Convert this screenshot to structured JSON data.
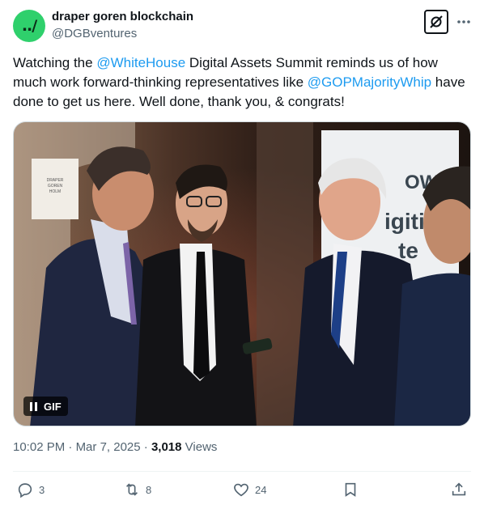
{
  "author": {
    "name": "draper goren blockchain",
    "handle": "@DGBventures",
    "avatar_text": "../",
    "avatar_color": "#2fd06c"
  },
  "header_icons": {
    "grok": "grok-icon",
    "more": "more-options-icon"
  },
  "tweet": {
    "text_1": "Watching the ",
    "mention_1": "@WhiteHouse",
    "text_2": " Digital Assets Summit reminds us of how much work forward-thinking representatives like ",
    "mention_2": "@GOPMajorityWhip",
    "text_3": " have done to get us here. Well done, thank you, & congrats!"
  },
  "media": {
    "type": "gif",
    "badge_label": "GIF",
    "pause_icon": "pause-icon",
    "visible_sign_text": "DRAPER GOREN HOLM",
    "banner_text_1": "OWN",
    "banner_text_2": "igitiz",
    "banner_text_3": "te"
  },
  "meta": {
    "time": "10:02 PM",
    "sep_1": " · ",
    "date": "Mar 7, 2025",
    "sep_2": " · ",
    "views_count": "3,018",
    "views_label": " Views"
  },
  "actions": {
    "replies": "3",
    "reposts": "8",
    "likes": "24"
  },
  "colors": {
    "link": "#1d9bf0",
    "secondary_text": "#536471",
    "primary_text": "#0f1419"
  }
}
